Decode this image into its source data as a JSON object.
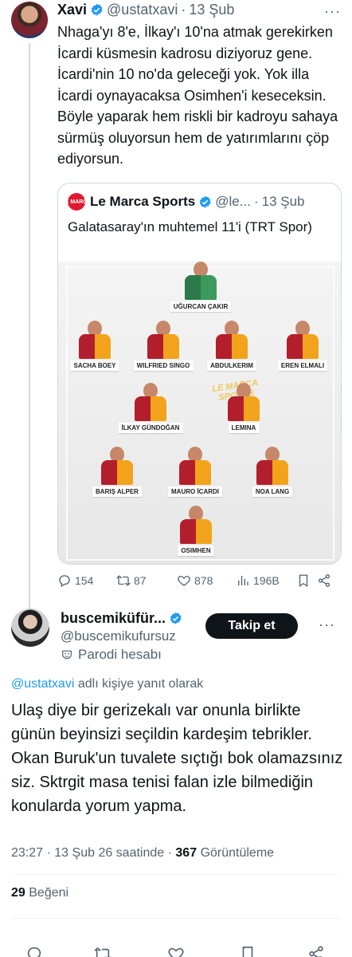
{
  "tweet": {
    "author_name": "Xavi",
    "handle": "@ustatxavi",
    "separator": "·",
    "date": "13 Şub",
    "text": "Nhaga'yı 8'e, İlkay'ı 10'na atmak gerekirken İcardi küsmesin kadrosu diziyoruz gene. İcardi'nin 10 no'da geleceği yok. Yok illa İcardi oynayacaksa Osimhen'i keseceksin. Böyle yaparak hem riskli bir kadroyu sahaya sürmüş oluyorsun hem de yatırımlarını çöp ediyorsun.",
    "more_icon": "more-icon",
    "quote": {
      "logo_text": "LE MARCA",
      "author_name": "Le Marca Sports",
      "handle": "@le...",
      "separator": "·",
      "date": "13 Şub",
      "text": "Galatasaray'ın muhtemel 11'i (TRT Spor)",
      "watermark": "LE MARCA SPORTS",
      "players": [
        "UĞURCAN ÇAKIR",
        "SACHA BOEY",
        "WILFRIED SINGO",
        "ABDULKERIM",
        "EREN ELMALI",
        "İLKAY GÜNDOĞAN",
        "LEMINA",
        "BARIŞ ALPER",
        "MAURO İCARDI",
        "NOA LANG",
        "OSIMHEN"
      ]
    },
    "actions": {
      "replies": "154",
      "reposts": "87",
      "likes": "878",
      "views": "196B"
    }
  },
  "reply": {
    "author_name": "buscemiküfür...",
    "handle": "@buscemikufursuz",
    "parody_label": "Parodi hesabı",
    "follow_label": "Takip et",
    "reply_to_mention": "@ustatxavi",
    "reply_to_suffix": "adlı kişiye yanıt olarak",
    "text": "Ulaş diye bir gerizekalı var onunla birlikte günün beyinsizi seçildin kardeşim tebrikler. Okan Buruk'un tuvalete sıçtığı bok olamazsınız siz. Sktrgit masa tenisi falan izle bilmediğin konularda yorum yapma.",
    "time": "23:27",
    "date": "13 Şub 26 saatinde",
    "dot": "·",
    "views_count": "367",
    "views_label": "Görüntüleme",
    "likes_count": "29",
    "likes_label": "Beğeni"
  },
  "colors": {
    "accent": "#1d9bf0",
    "text": "#0f1419",
    "secondary": "#536471",
    "border": "#cfd9de"
  }
}
